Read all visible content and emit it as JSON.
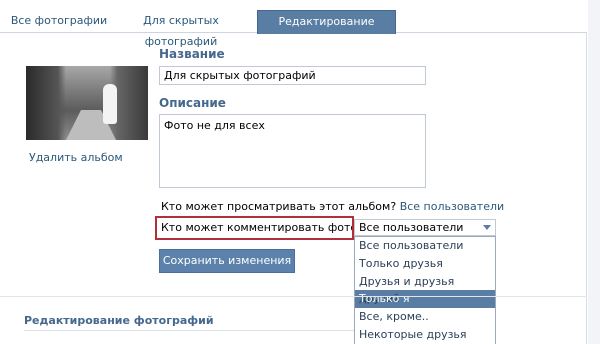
{
  "tabs": [
    {
      "label": "Все фотографии",
      "active": false
    },
    {
      "label": "Для скрытых фотографий",
      "active": false
    },
    {
      "label": "Редактирование альбома",
      "active": true
    }
  ],
  "album": {
    "delete_link": "Удалить альбом",
    "name_label": "Название",
    "name_value": "Для скрытых фотографий",
    "description_label": "Описание",
    "description_value": "Фото не для всех"
  },
  "privacy": {
    "view_question": "Кто может просматривать этот альбом?",
    "view_value": "Все пользователи",
    "comment_question": "Кто может комментировать фотографии?",
    "comment_value": "Все пользователи",
    "options": [
      "Все пользователи",
      "Только друзья",
      "Друзья и друзья друзей",
      "Только я",
      "Все, кроме..",
      "Некоторые друзья"
    ],
    "highlighted_option": "Только я"
  },
  "save_button": "Сохранить изменения",
  "section": {
    "title": "Редактирование фотографий"
  },
  "colors": {
    "accent": "#597da3",
    "link": "#2b587a",
    "label": "#45688e",
    "highlight_border": "#b0303a"
  }
}
